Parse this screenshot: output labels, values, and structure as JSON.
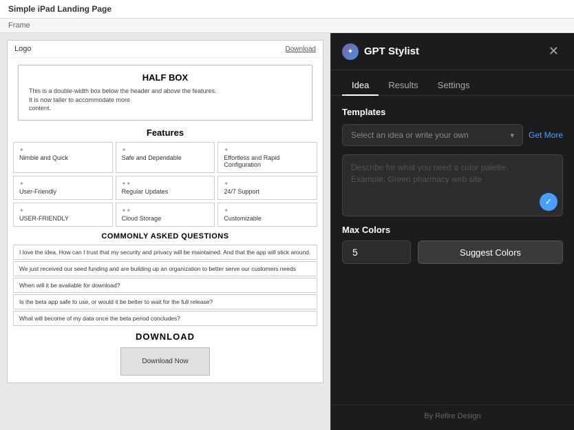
{
  "topbar": {
    "title": "Simple iPad Landing Page"
  },
  "frame": {
    "label": "Frame"
  },
  "preview": {
    "logo": "Logo",
    "download_link": "Download",
    "halfbox": {
      "title": "HALF BOX",
      "text_lines": [
        "This is a double-width box below the header and above the",
        "features.",
        "It is now taller to accommodate more",
        "content."
      ]
    },
    "features": {
      "title": "Features",
      "cards": [
        {
          "icon": "✦",
          "label": "Nimble and Quick"
        },
        {
          "icon": "✦",
          "label": "Safe and Dependable"
        },
        {
          "icon": "✦",
          "label": "Effortless and Rapid Configuration"
        },
        {
          "icon": "✦",
          "label": "User-Friendly"
        },
        {
          "icon": "✦✦",
          "label": "Regular Updates"
        },
        {
          "icon": "✦",
          "label": "24/7 Support"
        },
        {
          "icon": "✦",
          "label": "USER-FRIENDLY"
        },
        {
          "icon": "✦✦",
          "label": "Cloud Storage"
        },
        {
          "icon": "✦",
          "label": "Customizable"
        }
      ]
    },
    "faq": {
      "title": "COMMONLY ASKED QUESTIONS",
      "items": [
        "I love the idea. How can I trust that my security and privacy will be maintained. And that the app will stick around.",
        "We just received our seed funding and are building up an organization to better serve our customers needs",
        "When will it be available for download?",
        "Is the beta app safe to use, or would it be better to wait for the full release?",
        "What will become of my data once the beta period concludes?"
      ]
    },
    "download": {
      "title": "DOWNLOAD",
      "button_label": "Download Now"
    }
  },
  "gpt_panel": {
    "title": "GPT Stylist",
    "icon_symbol": "✦",
    "close_label": "✕",
    "tabs": [
      {
        "label": "Idea",
        "active": true
      },
      {
        "label": "Results",
        "active": false
      },
      {
        "label": "Settings",
        "active": false
      }
    ],
    "templates": {
      "section_label": "Templates",
      "dropdown_placeholder": "Select an idea or write your own",
      "get_more_label": "Get More"
    },
    "textarea": {
      "placeholder": "Describe for what you need a color palette. Example: Green pharmacy web site"
    },
    "max_colors": {
      "label": "Max Colors",
      "value": "5",
      "suggest_button_label": "Suggest Colors"
    },
    "footer": {
      "text": "By Refire Design"
    },
    "submit_icon": "✓"
  }
}
